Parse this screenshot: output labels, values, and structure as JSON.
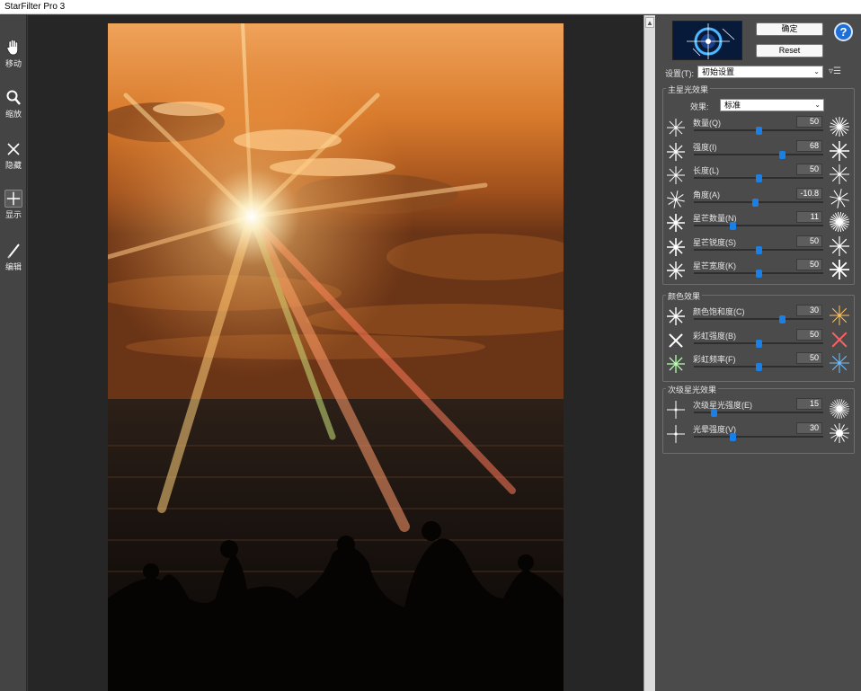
{
  "window": {
    "title": "StarFilter Pro 3"
  },
  "tools": [
    {
      "name": "move",
      "label": "移动"
    },
    {
      "name": "zoom",
      "label": "缩放"
    },
    {
      "name": "hide",
      "label": "隐藏"
    },
    {
      "name": "show",
      "label": "显示"
    },
    {
      "name": "edit",
      "label": "编辑"
    }
  ],
  "buttons": {
    "ok_label": "确定",
    "reset_label": "Reset",
    "help_label": "?"
  },
  "preset": {
    "label": "设置(T):",
    "value": "初始设置"
  },
  "main_group": {
    "title": "主星光效果",
    "effect_label": "效果:",
    "effect_value": "标准",
    "sliders": [
      {
        "label": "数量(Q)",
        "value": "50",
        "percent": 50
      },
      {
        "label": "强度(I)",
        "value": "68",
        "percent": 68
      },
      {
        "label": "长度(L)",
        "value": "50",
        "percent": 50
      },
      {
        "label": "角度(A)",
        "value": "-10.8",
        "percent": 47
      },
      {
        "label": "星芒数量(N)",
        "value": "11",
        "percent": 30
      },
      {
        "label": "星芒锐度(S)",
        "value": "50",
        "percent": 50
      },
      {
        "label": "星芒宽度(K)",
        "value": "50",
        "percent": 50
      }
    ]
  },
  "color_group": {
    "title": "颜色效果",
    "sliders": [
      {
        "label": "颜色饱和度(C)",
        "value": "30",
        "percent": 68
      },
      {
        "label": "彩虹强度(B)",
        "value": "50",
        "percent": 50
      },
      {
        "label": "彩虹频率(F)",
        "value": "50",
        "percent": 50
      }
    ]
  },
  "secondary_group": {
    "title": "次级星光效果",
    "sliders": [
      {
        "label": "次级星光强度(E)",
        "value": "15",
        "percent": 15
      },
      {
        "label": "光晕强度(V)",
        "value": "30",
        "percent": 30
      }
    ]
  },
  "colors": {
    "accent": "#1a7fe6",
    "panel_bg": "#4b4b4b",
    "help_blue": "#1f6fd8"
  }
}
